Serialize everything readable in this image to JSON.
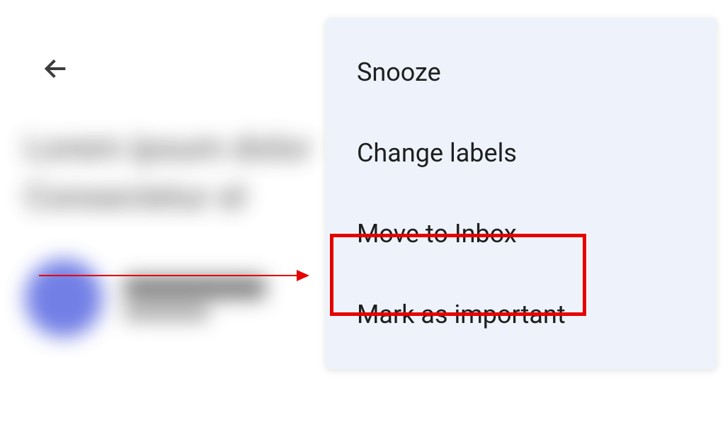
{
  "menu": {
    "items": [
      {
        "label": "Snooze"
      },
      {
        "label": "Change labels"
      },
      {
        "label": "Move to Inbox"
      },
      {
        "label": "Mark as important"
      }
    ]
  },
  "annotation": {
    "highlightedIndex": 2
  }
}
